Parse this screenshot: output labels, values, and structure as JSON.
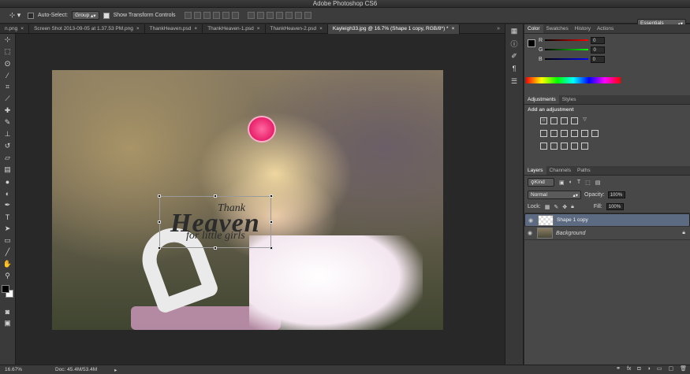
{
  "app": {
    "title": "Adobe Photoshop CS6"
  },
  "options": {
    "auto_select_label": "Auto-Select:",
    "auto_select_value": "Group",
    "show_transform_label": "Show Transform Controls",
    "workspace": "Essentials"
  },
  "tabs": [
    {
      "label": "n.png"
    },
    {
      "label": "Screen Shot 2013-09-05 at 1.37.53 PM.png"
    },
    {
      "label": "ThankHeaven.psd"
    },
    {
      "label": "ThankHeaven-1.psd"
    },
    {
      "label": "ThankHeaven-2.psd"
    },
    {
      "label": "Kayleigh33.jpg @ 16.7% (Shape 1 copy, RGB/8*) *"
    }
  ],
  "tabs_more": "»",
  "canvas": {
    "text_line1": "Thank",
    "text_line2": "Heaven",
    "text_line3": "for little girls"
  },
  "color_panel": {
    "tabs": [
      "Color",
      "Swatches",
      "History",
      "Actions"
    ],
    "r_label": "R",
    "r_value": "0",
    "g_label": "G",
    "g_value": "0",
    "b_label": "B",
    "b_value": "0"
  },
  "adjust_panel": {
    "tabs": [
      "Adjustments",
      "Styles"
    ],
    "heading": "Add an adjustment"
  },
  "layers_panel": {
    "tabs": [
      "Layers",
      "Channels",
      "Paths"
    ],
    "kind_label": "Kind",
    "blend_mode": "Normal",
    "opacity_label": "Opacity:",
    "opacity_value": "100%",
    "lock_label": "Lock:",
    "fill_label": "Fill:",
    "fill_value": "100%",
    "layers": [
      {
        "name": "Shape 1 copy",
        "selected": true
      },
      {
        "name": "Background",
        "selected": false
      }
    ]
  },
  "status": {
    "zoom": "16.67%",
    "doc": "Doc: 45.4M/53.4M"
  },
  "colors": {
    "accent": "#5d6b82",
    "bow": "#e8206a"
  }
}
